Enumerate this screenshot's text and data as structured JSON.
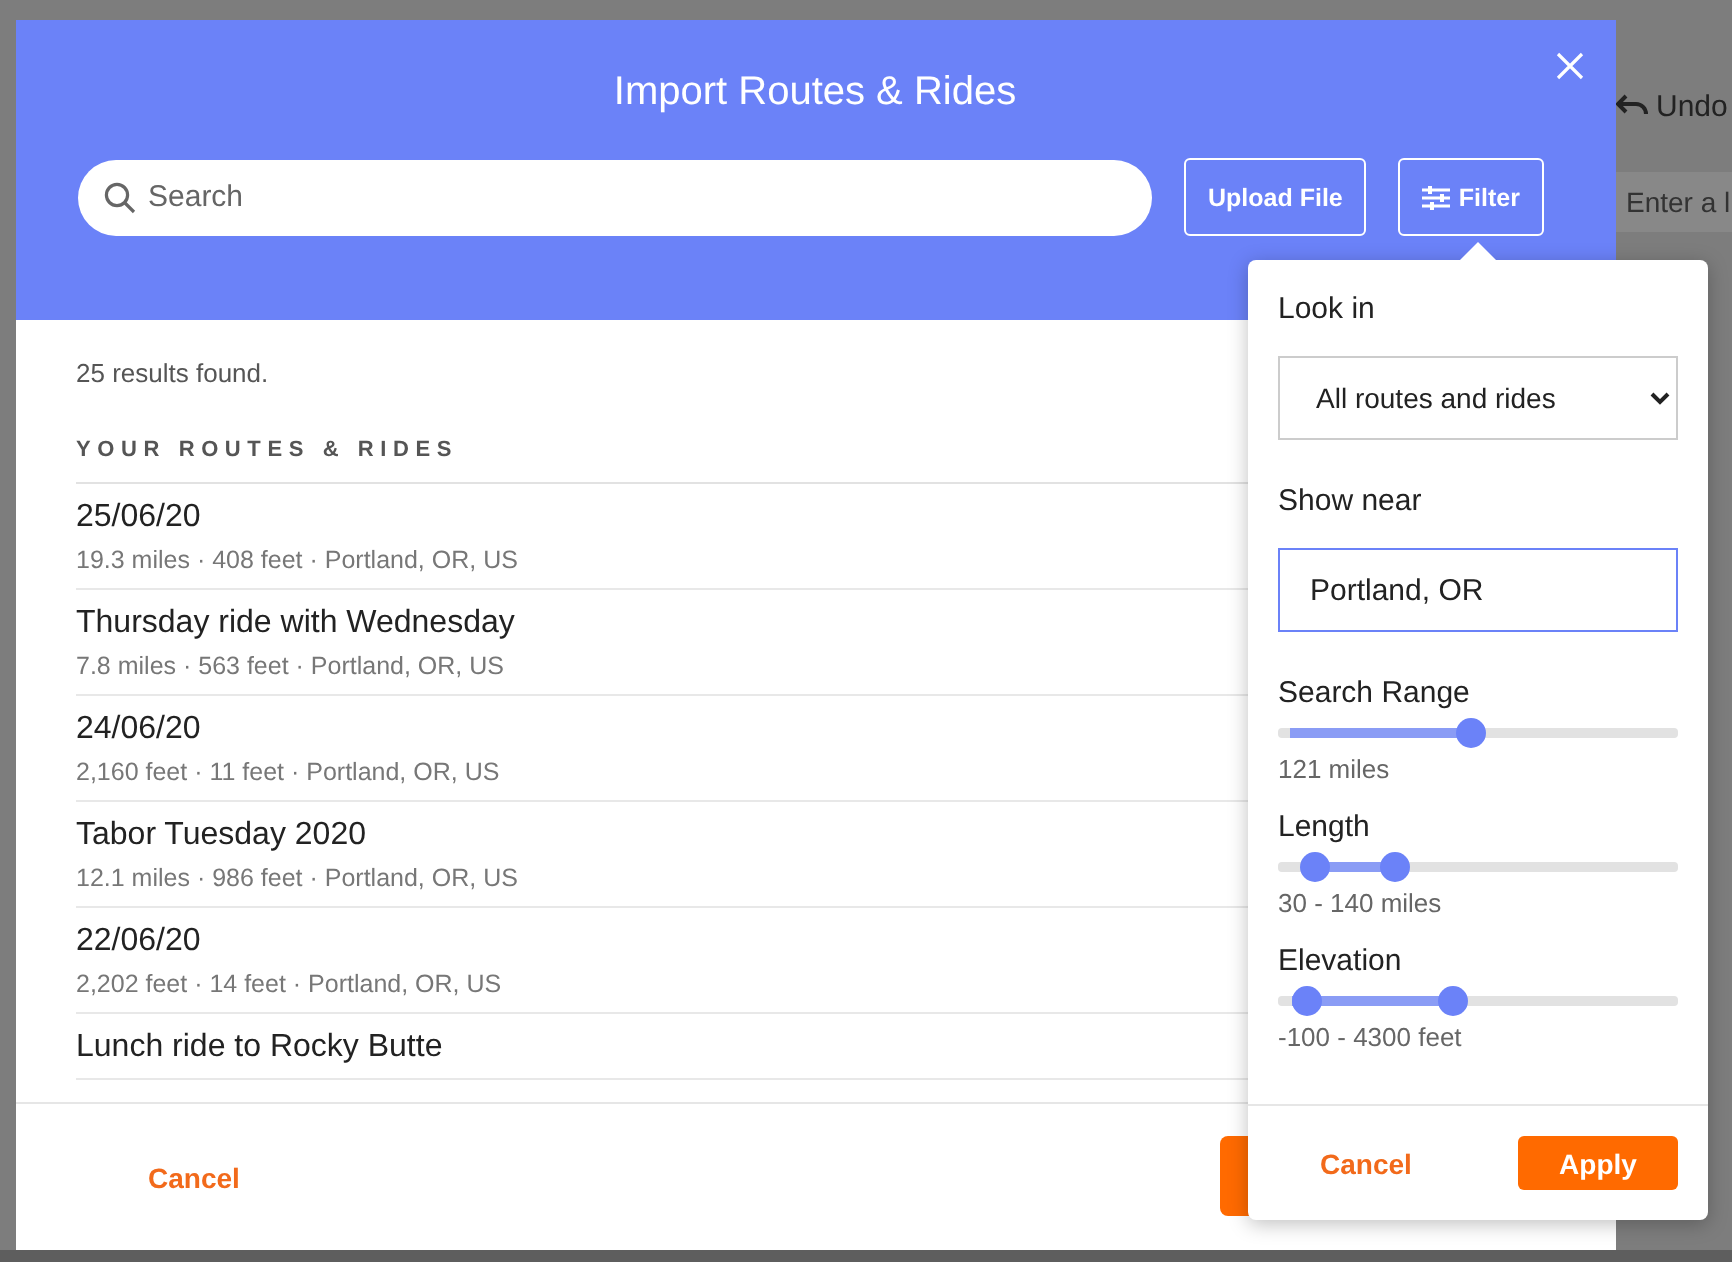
{
  "background": {
    "undo_label": "Undo",
    "location_placeholder": "Enter a l"
  },
  "dialog": {
    "title": "Import Routes & Rides",
    "search": {
      "placeholder": "Search"
    },
    "buttons": [
      "Upload File",
      "Filter"
    ],
    "results_count": "25 results found.",
    "section_heading": "YOUR ROUTES & RIDES",
    "rows": [
      {
        "title": "25/06/20",
        "details": "19.3 miles · 408 feet · Portland, OR, US"
      },
      {
        "title": "Thursday ride with Wednesday",
        "details": "7.8 miles · 563 feet · Portland, OR, US"
      },
      {
        "title": "24/06/20",
        "details": "2,160 feet · 11 feet · Portland, OR, US"
      },
      {
        "title": "Tabor Tuesday 2020",
        "details": "12.1 miles · 986 feet · Portland, OR, US"
      },
      {
        "title": "22/06/20",
        "details": "2,202 feet · 14 feet · Portland, OR, US"
      },
      {
        "title": "Lunch ride to Rocky Butte"
      }
    ],
    "cancel_label": "Cancel"
  },
  "filter": {
    "look_in_label": "Look in",
    "look_in_value": "All routes and rides",
    "show_near_label": "Show near",
    "show_near_value": "Portland, OR",
    "sliders": [
      {
        "kind": "single",
        "label": "Search Range",
        "reading": "121 miles",
        "thumbs": [
          {
            "level": 0.48
          }
        ]
      },
      {
        "kind": "range",
        "label": "Length",
        "reading": "30 - 140 miles",
        "thumbs": [
          {
            "level": 0.09
          },
          {
            "level": 0.29
          }
        ]
      },
      {
        "kind": "range",
        "label": "Elevation",
        "reading": "-100 - 4300 feet",
        "thumbs": [
          {
            "level": 0.035
          },
          {
            "level": 0.435
          }
        ]
      }
    ],
    "cancel_label": "Cancel",
    "apply_label": "Apply"
  }
}
